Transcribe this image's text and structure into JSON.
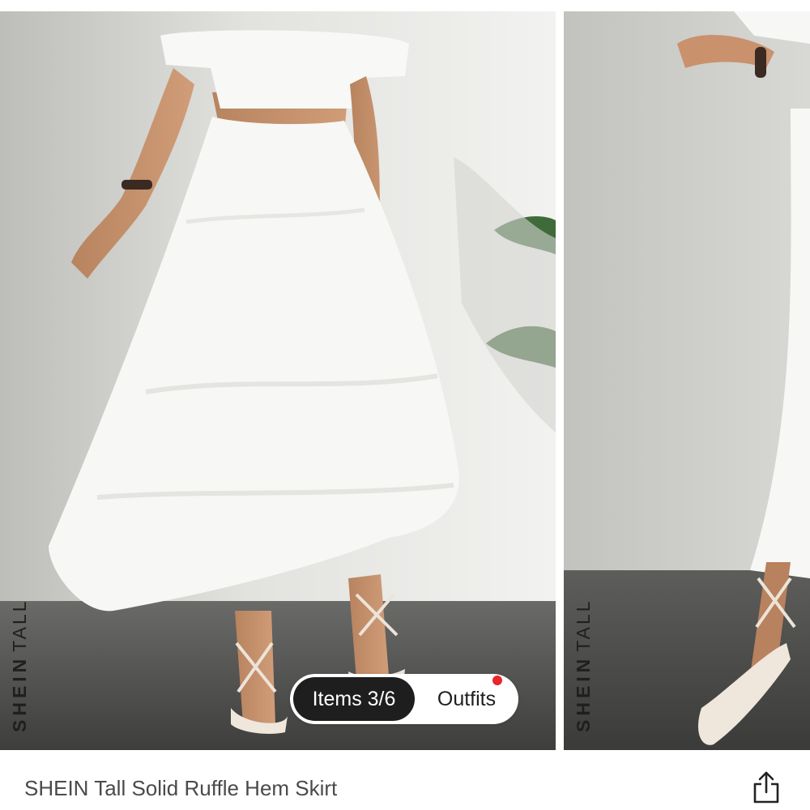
{
  "gallery": {
    "brand_bold": "SHEIN",
    "brand_regular": "TALL",
    "segmented": {
      "items_label": "Items 3/6",
      "outfits_label": "Outfits"
    }
  },
  "product": {
    "title": "SHEIN Tall Solid Ruffle Hem Skirt"
  },
  "colors": {
    "wall": "#e4e4e2",
    "floor": "#4e4e4c",
    "garment": "#f7f7f5",
    "accent_dot": "#e8262b",
    "pill_active": "#1e1e1e"
  },
  "icons": {
    "share": "share-icon"
  }
}
